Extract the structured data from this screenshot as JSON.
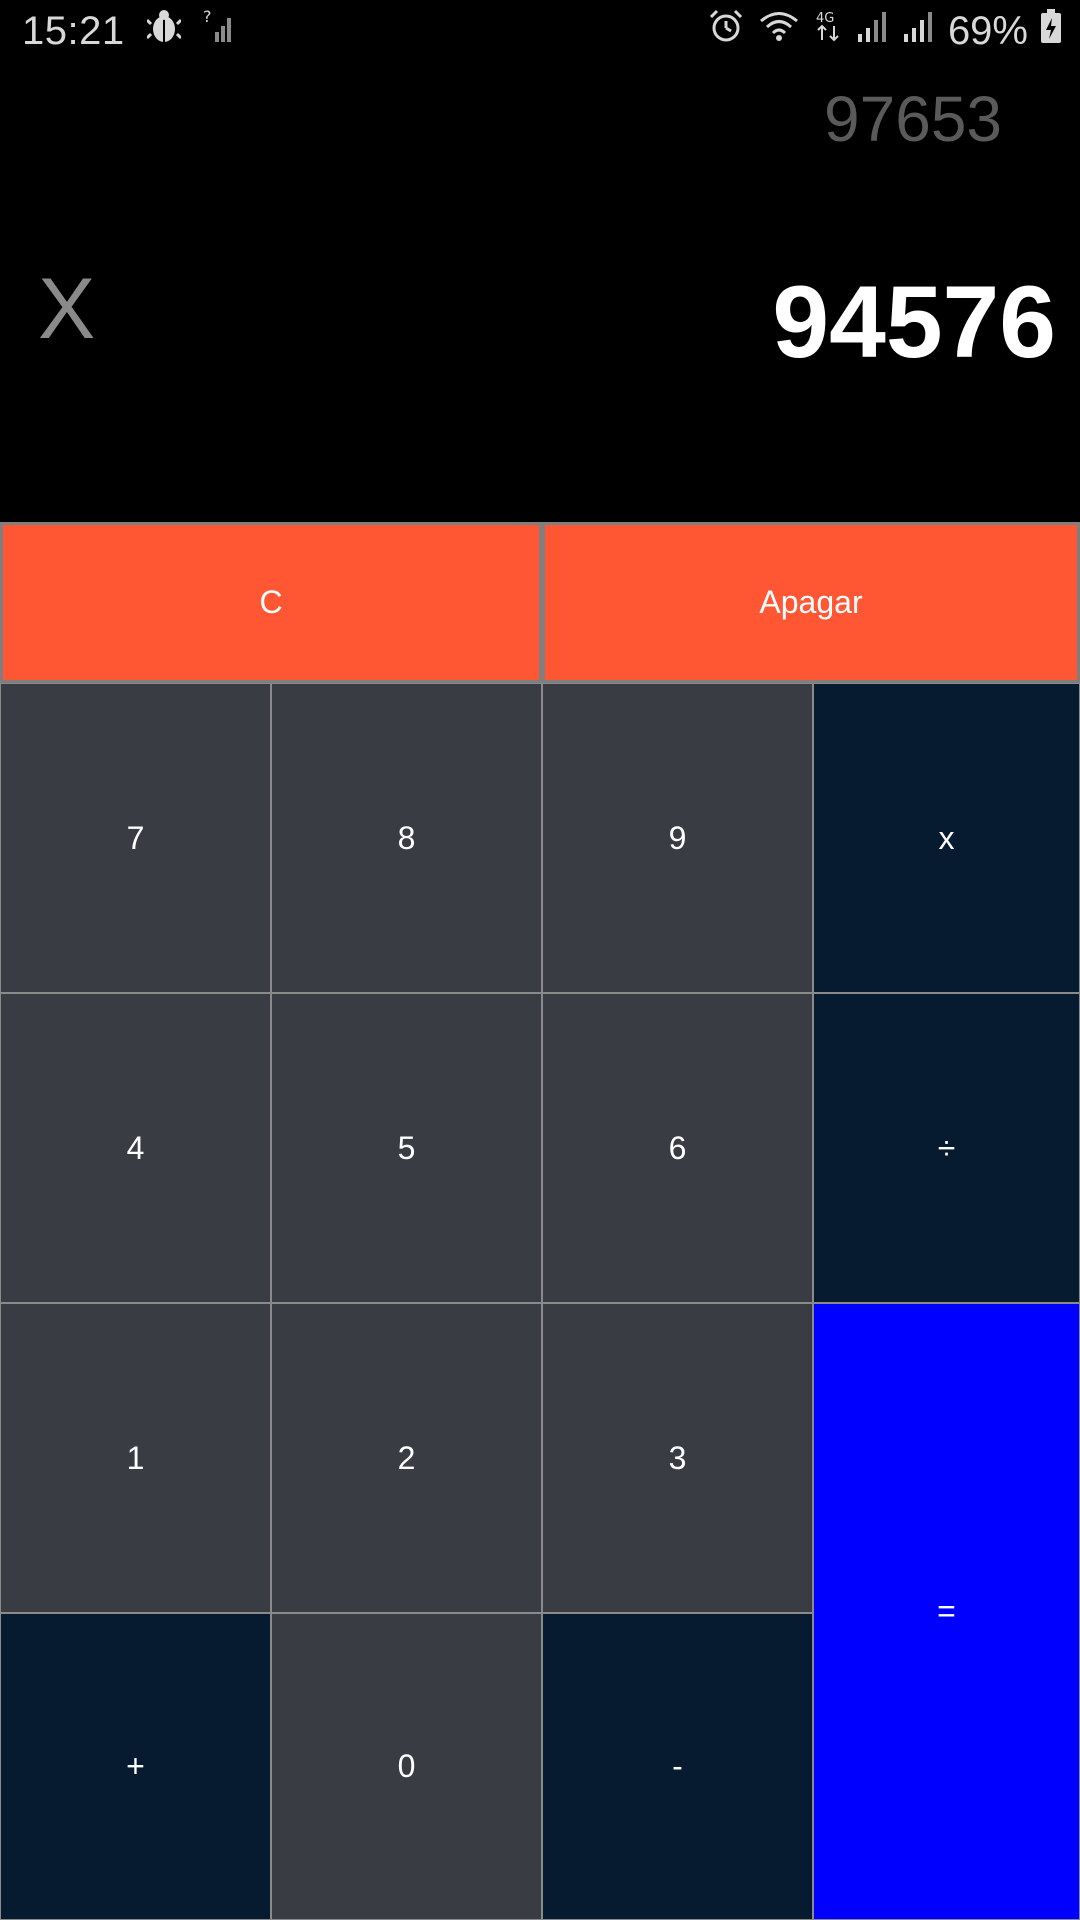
{
  "status_bar": {
    "time": "15:21",
    "battery": "69%",
    "icons": [
      "bug-icon",
      "no-signal-icon",
      "alarm-icon",
      "wifi-icon",
      "4g-icon",
      "signal-icon",
      "battery-icon"
    ]
  },
  "display": {
    "previous": "97653",
    "operator": "X",
    "current": "94576"
  },
  "keys": {
    "clear": "C",
    "delete": "Apagar",
    "k7": "7",
    "k8": "8",
    "k9": "9",
    "multiply": "x",
    "k4": "4",
    "k5": "5",
    "k6": "6",
    "divide": "÷",
    "k1": "1",
    "k2": "2",
    "k3": "3",
    "equals": "=",
    "plus": "+",
    "k0": "0",
    "minus": "-"
  },
  "colors": {
    "top_row": "#ff5733",
    "number_key": "#393c43",
    "operator_key": "#061a30",
    "equals_key": "#0000ff",
    "background": "#000000"
  }
}
